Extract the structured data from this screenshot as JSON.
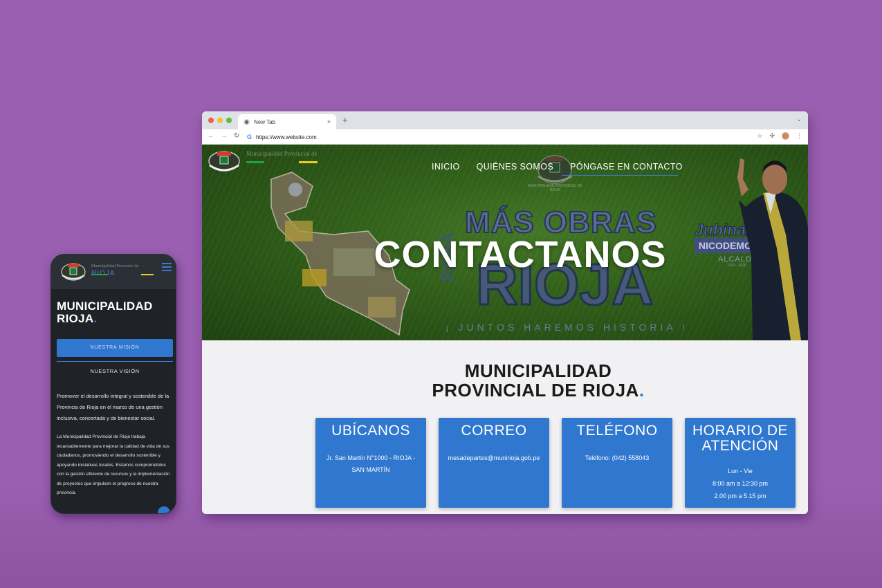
{
  "phone": {
    "brand_small": "Municipalidad Provincial de",
    "brand_big": "RIOJA",
    "title_line1": "MUNICIPALIDAD",
    "title_line2": "RIOJA",
    "title_dot": ".",
    "mision_button": "NUESTRA MISIÓN",
    "vision_button": "NUESTRA VISIÓN",
    "paragraph1": "Promover el desarrollo integral y sostenible de la Provincia de Rioja en el marco de una gestión inclusiva, concertada y de bienestar social.",
    "paragraph2": "La Municipalidad Provincial de Rioja trabaja incansablemente para mejorar la calidad de vida de sus ciudadanos, promoviendo el desarrollo sostenible y apoyando iniciativas locales. Estamos comprometidos con la gestión eficiente de recursos y la implementación de proyectos que impulsen el progreso de nuestra provincia."
  },
  "browser": {
    "tab_title": "New Tab",
    "tab_close": "×",
    "new_tab": "+",
    "url": "https://www.website.com",
    "icons": [
      "back-arrow-icon",
      "forward-arrow-icon",
      "reload-icon",
      "star-icon",
      "extensions-icon",
      "kebab-menu-icon"
    ]
  },
  "site": {
    "brand": "Municipalidad Provincial de",
    "nav": [
      "INICIO",
      "QUIÉNES SOMOS",
      "PÓNGASE EN CONTACTO"
    ],
    "hero_heading": "CONTACTANOS",
    "banner": {
      "mas_obras": "MÁS OBRAS",
      "para": "PARA",
      "rioja": "RIOJA",
      "jubinal": "Jubinal",
      "nicodemos": "NICODEMOS",
      "alcalde": "ALCALDE",
      "years": "2023 - 2026",
      "juntos": "¡ JUNTOS HAREMOS HISTORIA !",
      "seal_caption": "MUNICIPALIDAD PROVINCIAL DE RIOJA"
    },
    "content_title_line1": "MUNICIPALIDAD",
    "content_title_line2": "PROVINCIAL DE RIOJA",
    "content_title_dot": ".",
    "cards": [
      {
        "title": "UBÍCANOS",
        "body": "Jr. San Martín N°1000 - RIOJA - SAN MARTÍN"
      },
      {
        "title": "CORREO",
        "body": "mesadepartes@munirioja.gob.pe"
      },
      {
        "title": "TELÉFONO",
        "body": "Teléfono: (042) 558043"
      },
      {
        "title_line1": "HORARIO DE",
        "title_line2": "ATENCIÓN",
        "days": "Lun - Vie",
        "morning": "8:00 am a 12:30 pm",
        "afternoon": "2.00 pm a 5.15 pm"
      }
    ]
  },
  "colors": {
    "background": "#9a5fb0",
    "accent_blue": "#2f77cf",
    "hero_green": "#3a701f",
    "brand_green": "#21a33c",
    "brand_yellow": "#e6d021"
  }
}
